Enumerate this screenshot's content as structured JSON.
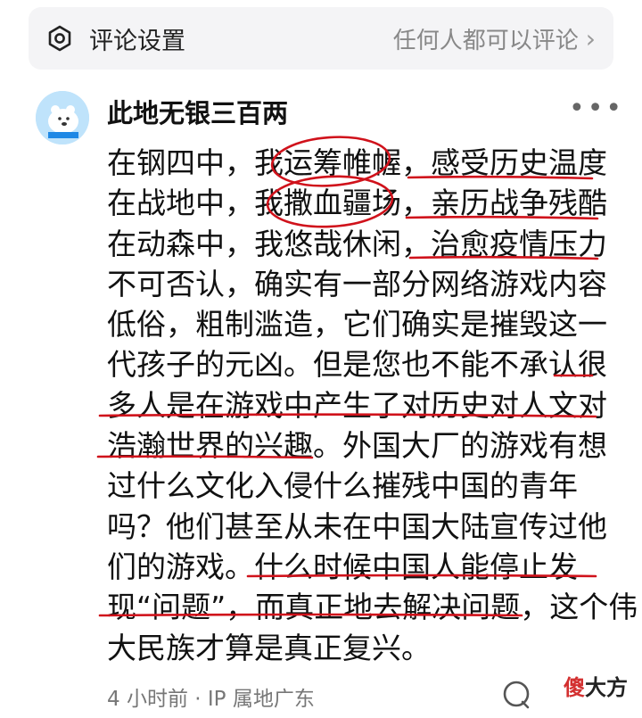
{
  "settings": {
    "label": "评论设置",
    "value": "任何人都可以评论",
    "icon": "gear-icon",
    "chevron": "›"
  },
  "comment": {
    "username": "此地无银三百两",
    "more_label": "•••",
    "lines": [
      "在钢四中，我运筹帷幄，感受历史温度",
      "在战地中，我撒血疆场，亲历战争残酷",
      "在动森中，我悠哉休闲，治愈疫情压力",
      "不可否认，确实有一部分网络游戏内容",
      "低俗，粗制滥造，它们确实是摧毁这一",
      "代孩子的元凶。但是您也不能不承认很",
      "多人是在游戏中产生了对历史对人文对",
      "浩瀚世界的兴趣。外国大厂的游戏有想",
      "过什么文化入侵什么摧残中国的青年",
      "吗？他们甚至从未在中国大陆宣传过他",
      "们的游戏。什么时候中国人能停止发",
      "现“问题”，而真正地去解决问题，这个伟",
      "大民族才算是真正复兴。"
    ],
    "meta": "4 小时前 · IP 属地广东"
  },
  "watermark": {
    "part1": "傻",
    "part2": "大方"
  },
  "colors": {
    "annotation": "#d0121b",
    "settings_bg": "#f4f4f6"
  }
}
